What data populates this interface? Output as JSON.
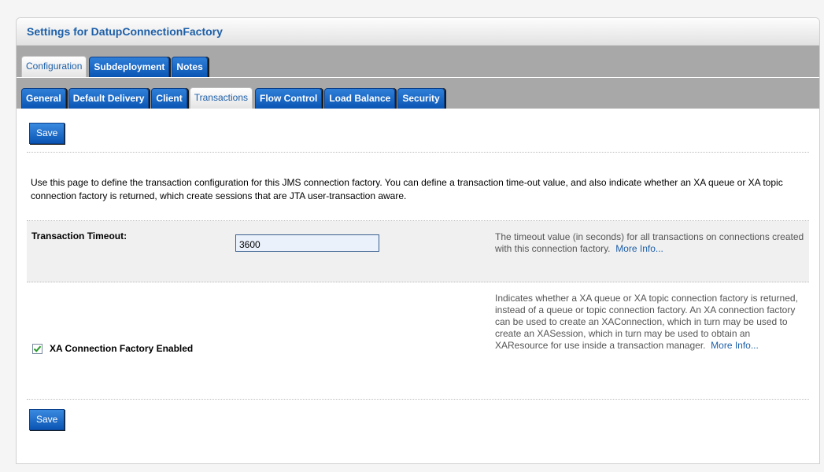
{
  "header": {
    "title": "Settings for DatupConnectionFactory"
  },
  "tabs_primary": [
    {
      "label": "Configuration",
      "active": true
    },
    {
      "label": "Subdeployment",
      "active": false
    },
    {
      "label": "Notes",
      "active": false
    }
  ],
  "tabs_secondary": [
    {
      "label": "General",
      "active": false
    },
    {
      "label": "Default Delivery",
      "active": false
    },
    {
      "label": "Client",
      "active": false
    },
    {
      "label": "Transactions",
      "active": true
    },
    {
      "label": "Flow Control",
      "active": false
    },
    {
      "label": "Load Balance",
      "active": false
    },
    {
      "label": "Security",
      "active": false
    }
  ],
  "toolbar": {
    "save_label": "Save"
  },
  "intro": "Use this page to define the transaction configuration for this JMS connection factory. You can define a transaction time-out value, and also indicate whether an XA queue or XA topic connection factory is returned, which create sessions that are JTA user-transaction aware.",
  "timeout": {
    "label": "Transaction Timeout:",
    "value": "3600",
    "help": "The timeout value (in seconds) for all transactions on connections created with this connection factory.",
    "more": "More Info..."
  },
  "xa": {
    "checked": true,
    "label": "XA Connection Factory Enabled",
    "help": "Indicates whether a XA queue or XA topic connection factory is returned, instead of a queue or topic connection factory. An XA connection factory can be used to create an XAConnection, which in turn may be used to create an XASession, which in turn may be used to obtain an XAResource for use inside a transaction manager.",
    "more": "More Info..."
  },
  "colors": {
    "accent": "#1d5fa8",
    "button": "#0a55b4",
    "tab_bar": "#a8a8a8"
  }
}
